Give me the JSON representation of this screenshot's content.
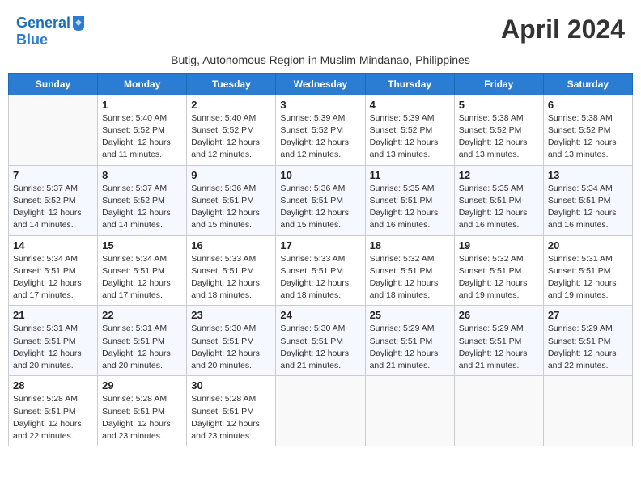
{
  "logo": {
    "line1": "General",
    "line2": "Blue"
  },
  "title": "April 2024",
  "subtitle": "Butig, Autonomous Region in Muslim Mindanao, Philippines",
  "days_of_week": [
    "Sunday",
    "Monday",
    "Tuesday",
    "Wednesday",
    "Thursday",
    "Friday",
    "Saturday"
  ],
  "weeks": [
    [
      {
        "day": "",
        "info": ""
      },
      {
        "day": "1",
        "info": "Sunrise: 5:40 AM\nSunset: 5:52 PM\nDaylight: 12 hours\nand 11 minutes."
      },
      {
        "day": "2",
        "info": "Sunrise: 5:40 AM\nSunset: 5:52 PM\nDaylight: 12 hours\nand 12 minutes."
      },
      {
        "day": "3",
        "info": "Sunrise: 5:39 AM\nSunset: 5:52 PM\nDaylight: 12 hours\nand 12 minutes."
      },
      {
        "day": "4",
        "info": "Sunrise: 5:39 AM\nSunset: 5:52 PM\nDaylight: 12 hours\nand 13 minutes."
      },
      {
        "day": "5",
        "info": "Sunrise: 5:38 AM\nSunset: 5:52 PM\nDaylight: 12 hours\nand 13 minutes."
      },
      {
        "day": "6",
        "info": "Sunrise: 5:38 AM\nSunset: 5:52 PM\nDaylight: 12 hours\nand 13 minutes."
      }
    ],
    [
      {
        "day": "7",
        "info": "Sunrise: 5:37 AM\nSunset: 5:52 PM\nDaylight: 12 hours\nand 14 minutes."
      },
      {
        "day": "8",
        "info": "Sunrise: 5:37 AM\nSunset: 5:52 PM\nDaylight: 12 hours\nand 14 minutes."
      },
      {
        "day": "9",
        "info": "Sunrise: 5:36 AM\nSunset: 5:51 PM\nDaylight: 12 hours\nand 15 minutes."
      },
      {
        "day": "10",
        "info": "Sunrise: 5:36 AM\nSunset: 5:51 PM\nDaylight: 12 hours\nand 15 minutes."
      },
      {
        "day": "11",
        "info": "Sunrise: 5:35 AM\nSunset: 5:51 PM\nDaylight: 12 hours\nand 16 minutes."
      },
      {
        "day": "12",
        "info": "Sunrise: 5:35 AM\nSunset: 5:51 PM\nDaylight: 12 hours\nand 16 minutes."
      },
      {
        "day": "13",
        "info": "Sunrise: 5:34 AM\nSunset: 5:51 PM\nDaylight: 12 hours\nand 16 minutes."
      }
    ],
    [
      {
        "day": "14",
        "info": "Sunrise: 5:34 AM\nSunset: 5:51 PM\nDaylight: 12 hours\nand 17 minutes."
      },
      {
        "day": "15",
        "info": "Sunrise: 5:34 AM\nSunset: 5:51 PM\nDaylight: 12 hours\nand 17 minutes."
      },
      {
        "day": "16",
        "info": "Sunrise: 5:33 AM\nSunset: 5:51 PM\nDaylight: 12 hours\nand 18 minutes."
      },
      {
        "day": "17",
        "info": "Sunrise: 5:33 AM\nSunset: 5:51 PM\nDaylight: 12 hours\nand 18 minutes."
      },
      {
        "day": "18",
        "info": "Sunrise: 5:32 AM\nSunset: 5:51 PM\nDaylight: 12 hours\nand 18 minutes."
      },
      {
        "day": "19",
        "info": "Sunrise: 5:32 AM\nSunset: 5:51 PM\nDaylight: 12 hours\nand 19 minutes."
      },
      {
        "day": "20",
        "info": "Sunrise: 5:31 AM\nSunset: 5:51 PM\nDaylight: 12 hours\nand 19 minutes."
      }
    ],
    [
      {
        "day": "21",
        "info": "Sunrise: 5:31 AM\nSunset: 5:51 PM\nDaylight: 12 hours\nand 20 minutes."
      },
      {
        "day": "22",
        "info": "Sunrise: 5:31 AM\nSunset: 5:51 PM\nDaylight: 12 hours\nand 20 minutes."
      },
      {
        "day": "23",
        "info": "Sunrise: 5:30 AM\nSunset: 5:51 PM\nDaylight: 12 hours\nand 20 minutes."
      },
      {
        "day": "24",
        "info": "Sunrise: 5:30 AM\nSunset: 5:51 PM\nDaylight: 12 hours\nand 21 minutes."
      },
      {
        "day": "25",
        "info": "Sunrise: 5:29 AM\nSunset: 5:51 PM\nDaylight: 12 hours\nand 21 minutes."
      },
      {
        "day": "26",
        "info": "Sunrise: 5:29 AM\nSunset: 5:51 PM\nDaylight: 12 hours\nand 21 minutes."
      },
      {
        "day": "27",
        "info": "Sunrise: 5:29 AM\nSunset: 5:51 PM\nDaylight: 12 hours\nand 22 minutes."
      }
    ],
    [
      {
        "day": "28",
        "info": "Sunrise: 5:28 AM\nSunset: 5:51 PM\nDaylight: 12 hours\nand 22 minutes."
      },
      {
        "day": "29",
        "info": "Sunrise: 5:28 AM\nSunset: 5:51 PM\nDaylight: 12 hours\nand 23 minutes."
      },
      {
        "day": "30",
        "info": "Sunrise: 5:28 AM\nSunset: 5:51 PM\nDaylight: 12 hours\nand 23 minutes."
      },
      {
        "day": "",
        "info": ""
      },
      {
        "day": "",
        "info": ""
      },
      {
        "day": "",
        "info": ""
      },
      {
        "day": "",
        "info": ""
      }
    ]
  ]
}
